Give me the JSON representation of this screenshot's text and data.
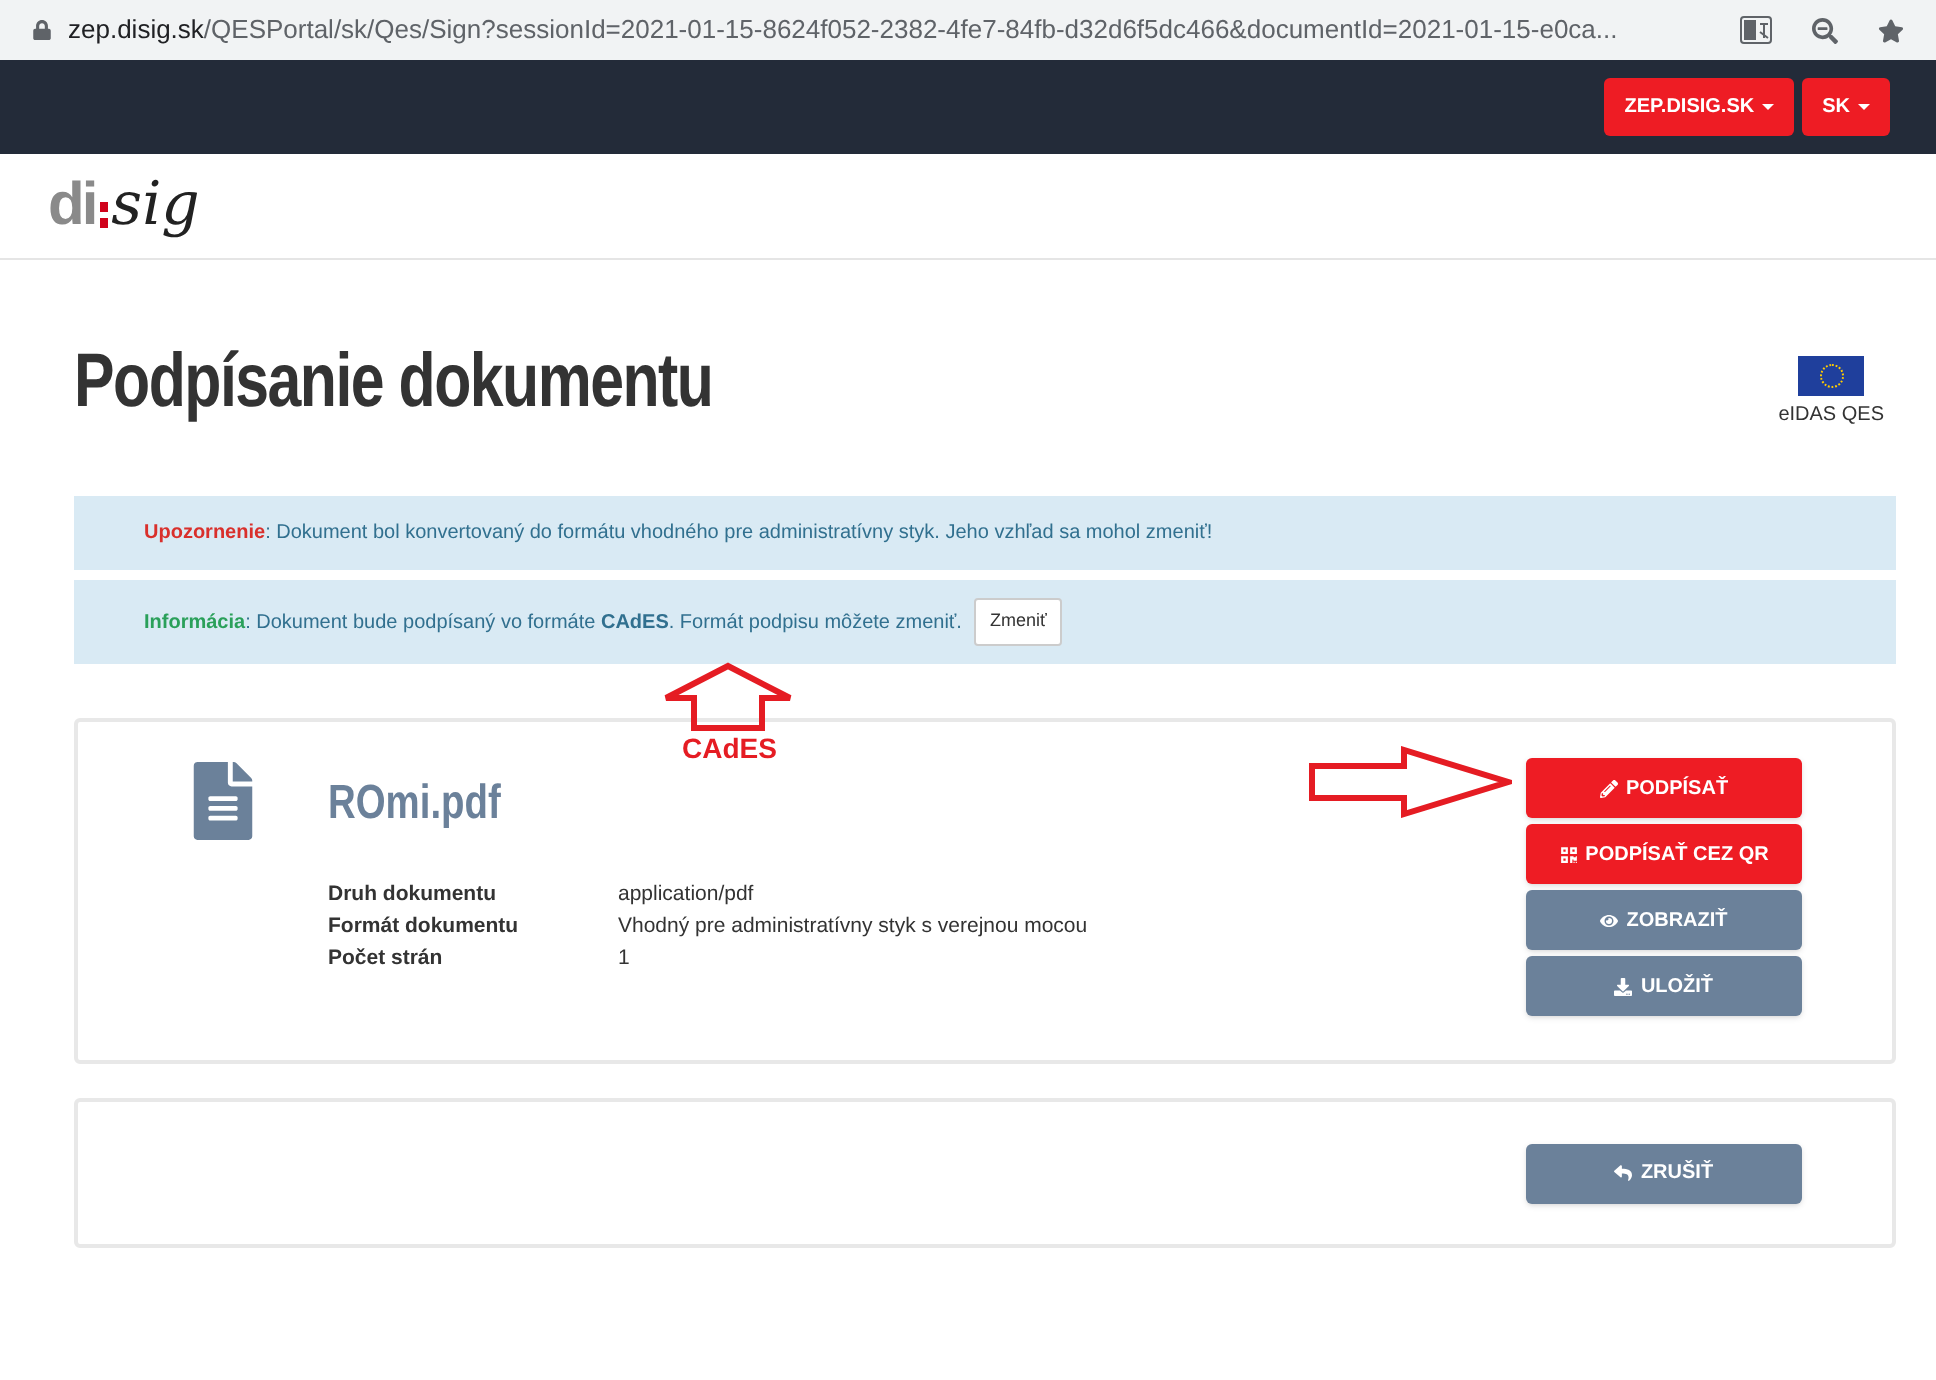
{
  "browser": {
    "url_host": "zep.disig.sk",
    "url_path": "/QESPortal/sk/Qes/Sign?sessionId=2021-01-15-8624f052-2382-4fe7-84fb-d32d6f5dc466&documentId=2021-01-15-e0ca..."
  },
  "navbar": {
    "menus": [
      "ZEP.DISIG.SK",
      "SK"
    ]
  },
  "logo": {
    "part_1": "di",
    "part_2": "sig"
  },
  "page_title": "Podpísanie dokumentu",
  "eidas_label": "eIDAS QES",
  "alerts": [
    {
      "kind": "warning",
      "label": "Upozornenie",
      "text": ": Dokument bol konvertovaný do formátu vhodného pre administratívny styk. Jeho vzhľad sa mohol zmeniť!"
    },
    {
      "kind": "info",
      "label": "Informácia",
      "text": ": Dokument bude podpísaný vo formáte **CAdES**. Formát podpisu môžete zmeniť.",
      "button": "Zmeniť"
    }
  ],
  "annotation": {
    "label": "CAdES"
  },
  "document": {
    "name": "ROmi.pdf",
    "details": [
      {
        "label": "Druh dokumentu",
        "value": "application/pdf"
      },
      {
        "label": "Formát dokumentu",
        "value": "Vhodný pre administratívny styk s verejnou mocou"
      },
      {
        "label": "Počet strán",
        "value": "1"
      }
    ],
    "buttons": [
      {
        "kind": "primary",
        "label": "PODPÍSAŤ"
      },
      {
        "kind": "primary",
        "label": "PODPÍSAŤ CEZ QR"
      },
      {
        "kind": "secondary",
        "label": "ZOBRAZIŤ"
      },
      {
        "kind": "secondary",
        "label": "ULOŽIŤ"
      }
    ]
  },
  "footer_buttons": [
    {
      "kind": "secondary",
      "label": "ZRUŠIŤ"
    }
  ]
}
